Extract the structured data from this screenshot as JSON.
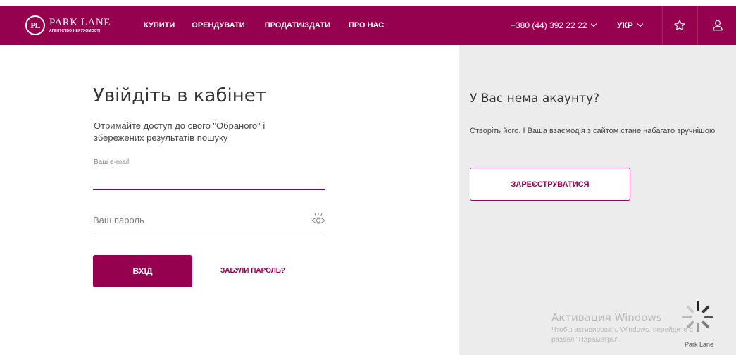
{
  "header": {
    "logo": {
      "monogram": "PL",
      "name": "PARK LANE",
      "tagline": "АГЕНТСТВО НЕРУХОМОСТІ"
    },
    "nav": [
      {
        "label": "КУПИТИ"
      },
      {
        "label": "ОРЕНДУВАТИ"
      },
      {
        "label": "ПРОДАТИ/ЗДАТИ"
      },
      {
        "label": "ПРО НАС"
      }
    ],
    "phone": "+380 (44) 392 22 22",
    "language": "УКР",
    "icons": [
      "star-icon",
      "user-icon"
    ]
  },
  "login": {
    "title": "Увійдіть в кабінет",
    "subtitle": "Отримайте доступ до свого \"Обраного\" і збережених результатів пошуку",
    "email_label": "Ваш e-mail",
    "password_placeholder": "Ваш пароль",
    "submit_label": "ВХІД",
    "forgot_label": "ЗАБУЛИ ПАРОЛЬ?"
  },
  "register": {
    "title": "У Вас нема акаунту?",
    "subtitle": "Створіть його. І Ваша взаємодія з сайтом стане набагато зручнішою",
    "button_label": "ЗАРЕЄСТРУВАТИСЯ"
  },
  "windows_watermark": {
    "title": "Активация Windows",
    "line1": "Чтобы активировать Windows, перейдите в",
    "line2": "раздел \"Параметры\"."
  },
  "loader_label": "Park Lane",
  "colors": {
    "brand": "#95004f",
    "panel": "#ececec"
  }
}
